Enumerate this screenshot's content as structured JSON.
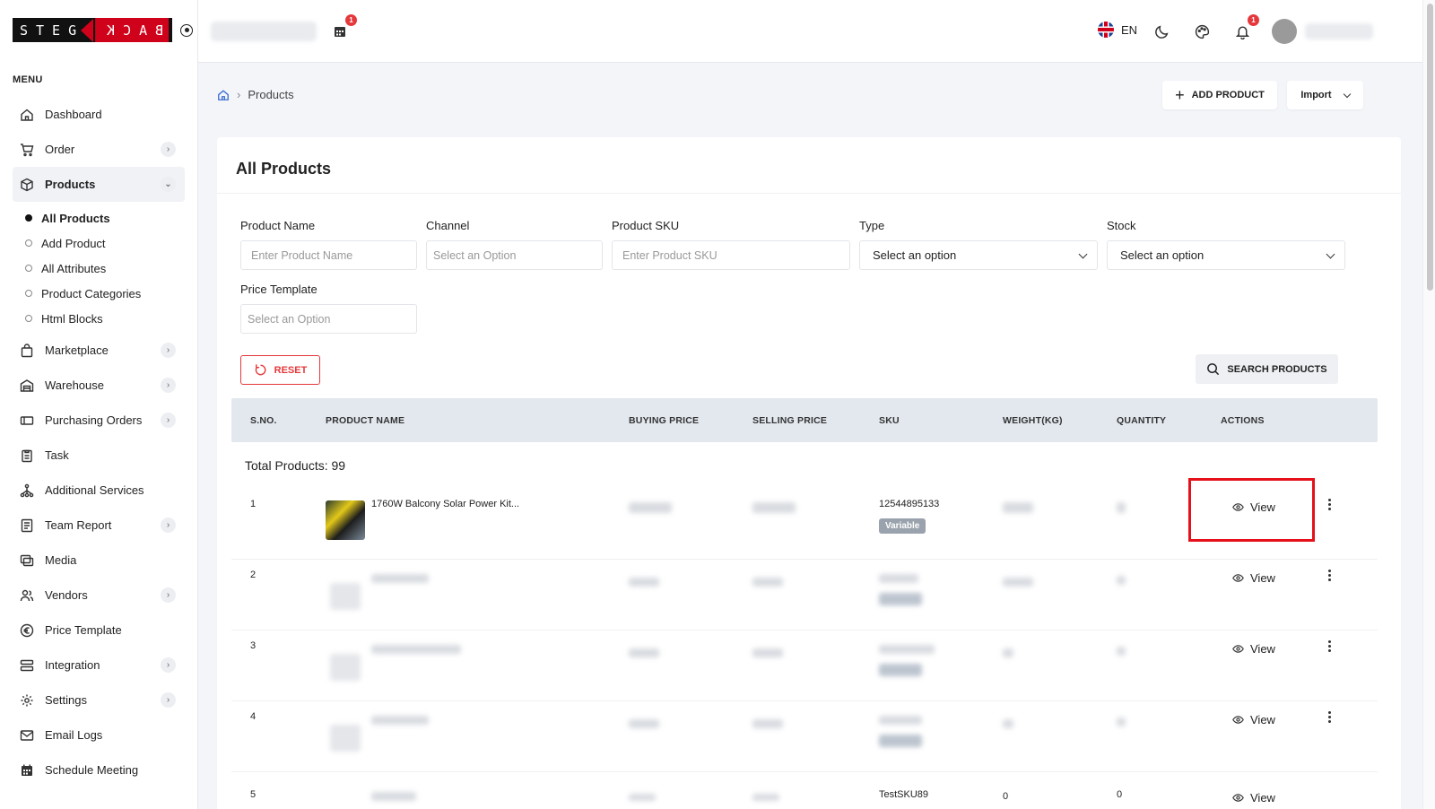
{
  "logo": {
    "left_text": "STEG",
    "right_text": "BACK"
  },
  "sidebar": {
    "menu_title": "MENU",
    "items": [
      {
        "label": "Dashboard",
        "icon": "home-icon"
      },
      {
        "label": "Order",
        "icon": "cart-icon"
      },
      {
        "label": "Products",
        "icon": "box-icon"
      },
      {
        "label": "Marketplace",
        "icon": "bag-icon"
      },
      {
        "label": "Warehouse",
        "icon": "warehouse-icon"
      },
      {
        "label": "Purchasing Orders",
        "icon": "tag-icon"
      },
      {
        "label": "Task",
        "icon": "clipboard-icon"
      },
      {
        "label": "Additional Services",
        "icon": "network-icon"
      },
      {
        "label": "Team Report",
        "icon": "report-icon"
      },
      {
        "label": "Media",
        "icon": "media-icon"
      },
      {
        "label": "Vendors",
        "icon": "users-icon"
      },
      {
        "label": "Price Template",
        "icon": "euro-icon"
      },
      {
        "label": "Integration",
        "icon": "integration-icon"
      },
      {
        "label": "Settings",
        "icon": "gear-icon"
      },
      {
        "label": "Email Logs",
        "icon": "mail-icon"
      },
      {
        "label": "Schedule Meeting",
        "icon": "calendar-icon"
      }
    ],
    "sub_items": [
      "All Products",
      "Add Product",
      "All Attributes",
      "Product Categories",
      "Html Blocks"
    ]
  },
  "topbar": {
    "calendar_badge": "1",
    "language": "EN",
    "notification_badge": "1"
  },
  "breadcrumb": {
    "current": "Products"
  },
  "actions": {
    "add_product": "ADD PRODUCT",
    "import": "Import"
  },
  "card": {
    "title": "All Products"
  },
  "filters": {
    "product_name": {
      "label": "Product Name",
      "placeholder": "Enter Product Name"
    },
    "channel": {
      "label": "Channel",
      "placeholder": "Select an Option"
    },
    "product_sku": {
      "label": "Product SKU",
      "placeholder": "Enter Product SKU"
    },
    "type": {
      "label": "Type",
      "value": "Select an option"
    },
    "stock": {
      "label": "Stock",
      "value": "Select an option"
    },
    "price_template": {
      "label": "Price Template",
      "placeholder": "Select an Option"
    },
    "reset_label": "RESET",
    "search_label": "SEARCH PRODUCTS"
  },
  "table": {
    "headers": [
      "S.NO.",
      "PRODUCT NAME",
      "BUYING PRICE",
      "SELLING PRICE",
      "SKU",
      "WEIGHT(KG)",
      "QUANTITY",
      "ACTIONS"
    ],
    "total_label": "Total Products: 99",
    "rows": [
      {
        "sno": "1",
        "name": "1760W Balcony Solar Power Kit...",
        "sku": "12544895133",
        "type": "Variable",
        "action": "View"
      },
      {
        "sno": "2",
        "action": "View"
      },
      {
        "sno": "3",
        "action": "View"
      },
      {
        "sno": "4",
        "action": "View"
      }
    ],
    "partial_row": {
      "sno": "5",
      "sku": "TestSKU89",
      "weight": "0",
      "quantity": "0",
      "action": "View"
    }
  }
}
